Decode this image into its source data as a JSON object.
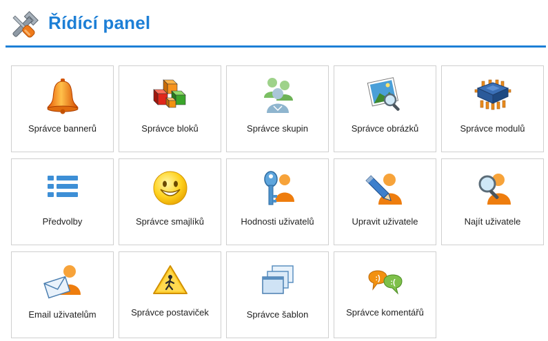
{
  "header": {
    "title": "Řídící panel",
    "icon": "tools-icon"
  },
  "colors": {
    "accent": "#1d7fd6",
    "tile_border": "#cfcfcf",
    "text": "#222222"
  },
  "tiles": [
    {
      "label": "Správce bannerů",
      "icon": "bell-icon"
    },
    {
      "label": "Správce bloků",
      "icon": "blocks-icon"
    },
    {
      "label": "Správce skupin",
      "icon": "users-group-icon"
    },
    {
      "label": "Správce obrázků",
      "icon": "image-search-icon"
    },
    {
      "label": "Správce modulů",
      "icon": "chip-module-icon"
    },
    {
      "label": "Předvolby",
      "icon": "list-icon"
    },
    {
      "label": "Správce smajlíků",
      "icon": "smiley-icon"
    },
    {
      "label": "Hodnosti uživatelů",
      "icon": "key-user-icon"
    },
    {
      "label": "Upravit uživatele",
      "icon": "pencil-user-icon"
    },
    {
      "label": "Najít uživatele",
      "icon": "search-user-icon"
    },
    {
      "label": "Email uživatelům",
      "icon": "email-user-icon"
    },
    {
      "label": "Správce postaviček",
      "icon": "warning-sign-icon"
    },
    {
      "label": "Správce šablon",
      "icon": "templates-icon"
    },
    {
      "label": "Správce komentářů",
      "icon": "comments-icon"
    }
  ]
}
